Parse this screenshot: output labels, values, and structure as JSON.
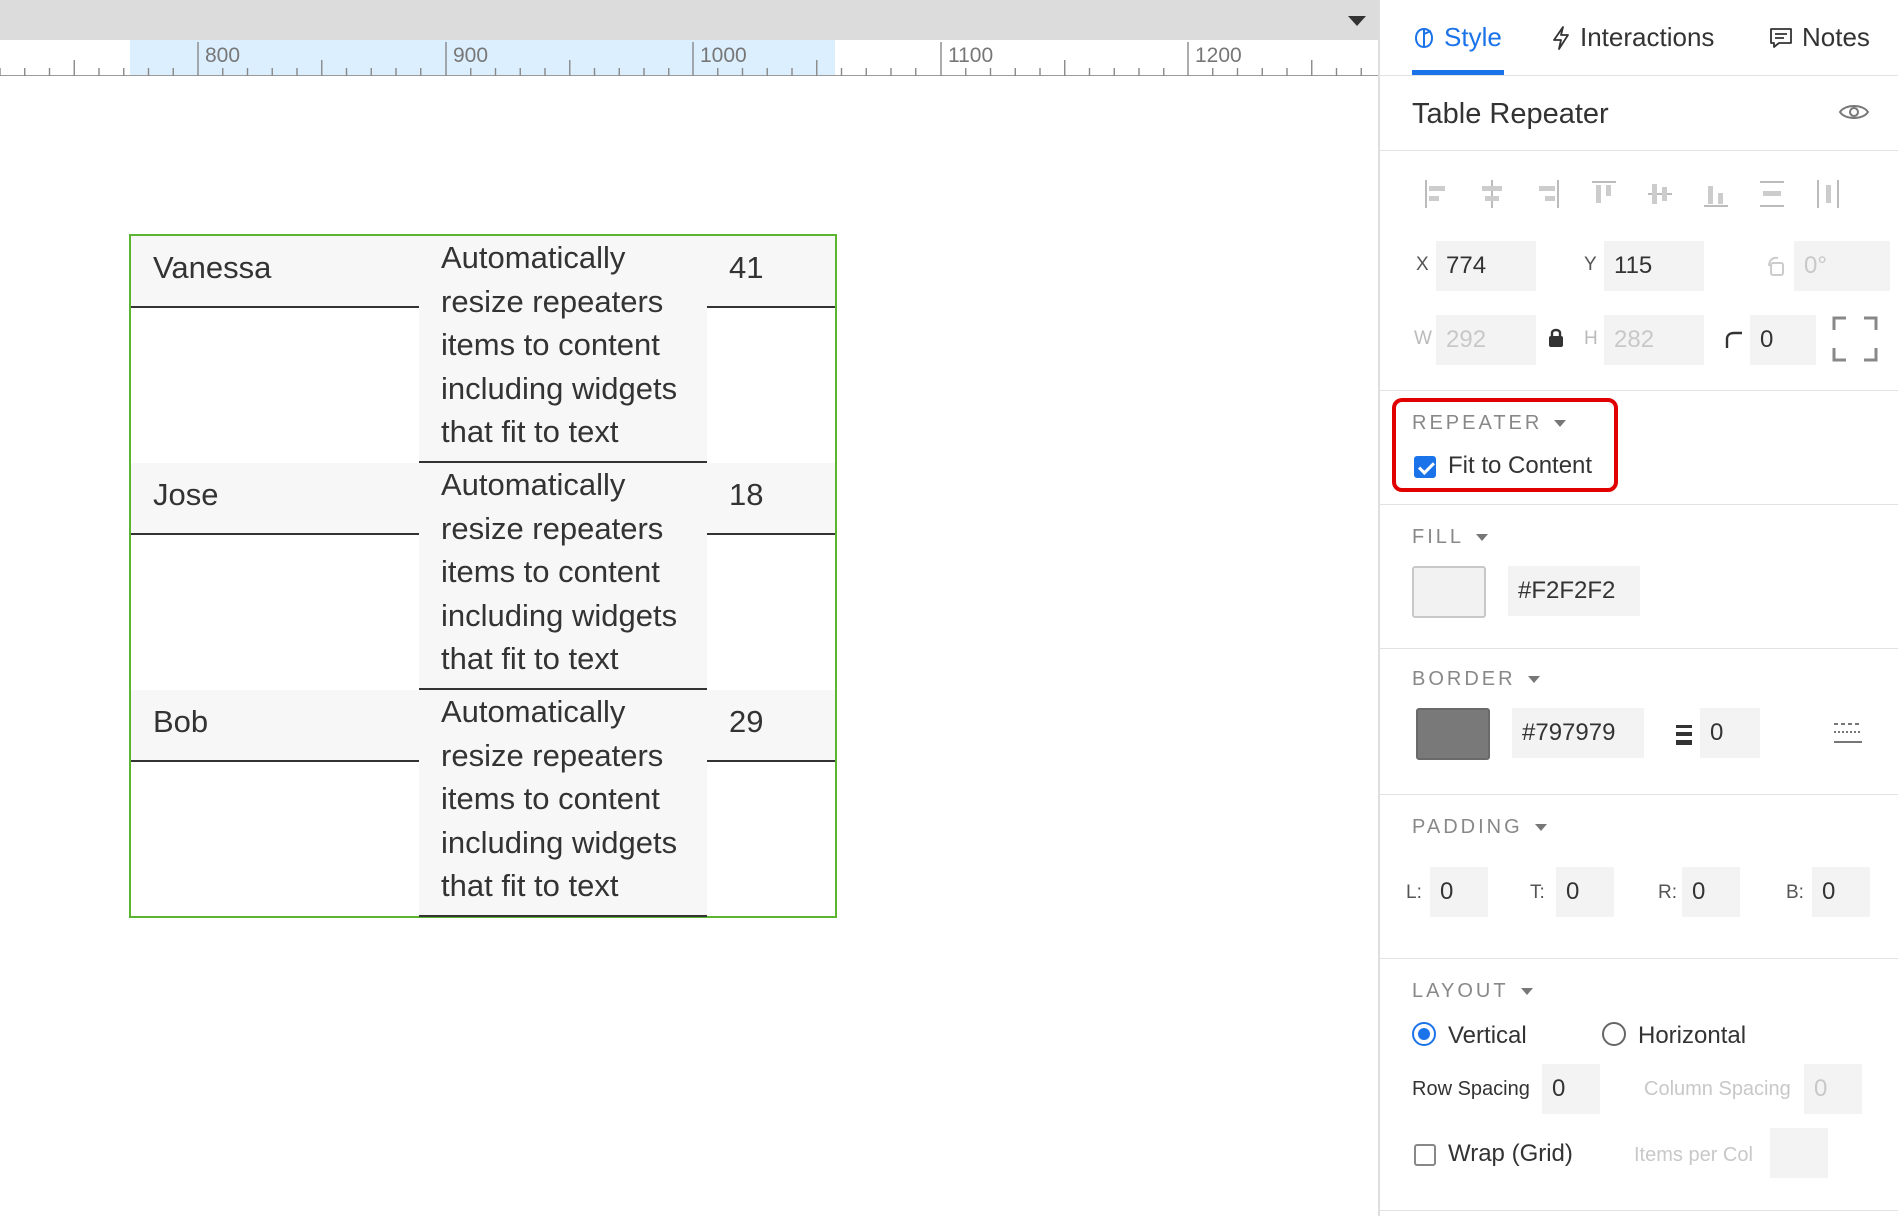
{
  "ruler": {
    "labels": [
      "800",
      "900",
      "1000",
      "1100",
      "1200"
    ]
  },
  "repeater": {
    "rows": [
      {
        "name": "Vanessa",
        "desc": [
          "Automatically",
          "resize repeaters",
          "items to content",
          "including widgets",
          "that fit to text"
        ],
        "age": "41"
      },
      {
        "name": "Jose",
        "desc": [
          "Automatically",
          "resize repeaters",
          "items to content",
          "including widgets",
          "that fit to text"
        ],
        "age": "18"
      },
      {
        "name": "Bob",
        "desc": [
          "Automatically",
          "resize repeaters",
          "items to content",
          "including widgets",
          "that fit to text"
        ],
        "age": "29"
      }
    ]
  },
  "panel": {
    "tabs": {
      "style": "Style",
      "interactions": "Interactions",
      "notes": "Notes"
    },
    "widget_title": "Table Repeater",
    "geometry": {
      "x_label": "X",
      "x": "774",
      "y_label": "Y",
      "y": "115",
      "rotation": "0°",
      "w_label": "W",
      "w": "292",
      "h_label": "H",
      "h": "282",
      "corner": "0"
    },
    "repeater_section": {
      "heading": "REPEATER",
      "fit_label": "Fit to Content",
      "fit_checked": true
    },
    "fill_section": {
      "heading": "FILL",
      "color": "#F2F2F2",
      "swatch": "#f2f2f2"
    },
    "border_section": {
      "heading": "BORDER",
      "color": "#797979",
      "swatch": "#797979",
      "width": "0"
    },
    "padding_section": {
      "heading": "PADDING",
      "l_label": "L:",
      "l": "0",
      "t_label": "T:",
      "t": "0",
      "r_label": "R:",
      "r": "0",
      "b_label": "B:",
      "b": "0"
    },
    "layout_section": {
      "heading": "LAYOUT",
      "vertical": "Vertical",
      "horizontal": "Horizontal",
      "row_spacing_label": "Row Spacing",
      "row_spacing": "0",
      "col_spacing_label": "Column Spacing",
      "col_spacing": "0",
      "wrap_label": "Wrap (Grid)",
      "items_per_col_label": "Items per Col"
    }
  }
}
